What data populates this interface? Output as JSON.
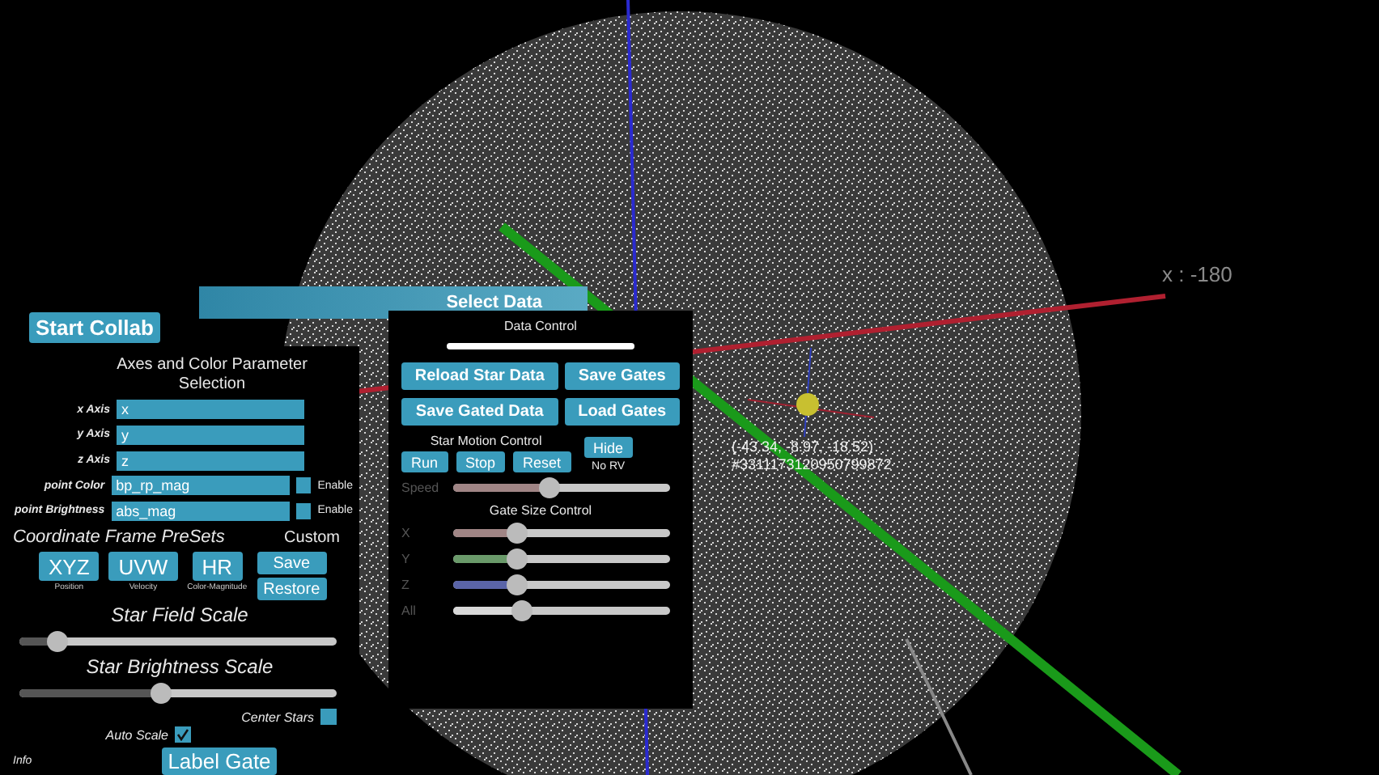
{
  "scene": {
    "axis_label": "x : -180",
    "star_coordinates": "(-43.34, -8.97, -18.52)",
    "star_id": "#3311173120950799872"
  },
  "top_bar": {
    "start_button": "Start Collab",
    "select_data": "Select Data"
  },
  "left_panel": {
    "title": "Axes and Color Parameter Selection",
    "fields": [
      {
        "label": "x Axis",
        "value": "x"
      },
      {
        "label": "y Axis",
        "value": "y"
      },
      {
        "label": "z Axis",
        "value": "z"
      },
      {
        "label": "point Color",
        "value": "bp_rp_mag",
        "enable": {
          "label": "Enable",
          "checked": false
        }
      },
      {
        "label": "point Brightness",
        "value": "abs_mag",
        "enable": {
          "label": "Enable",
          "checked": false
        }
      }
    ],
    "presets": {
      "title": "Coordinate Frame PreSets",
      "custom_label": "Custom",
      "custom_buttons": [
        "Save",
        "Restore"
      ],
      "frames": [
        {
          "label": "XYZ",
          "caption": "Position"
        },
        {
          "label": "UVW",
          "caption": "Velocity"
        },
        {
          "label": "HR",
          "caption": "Color-Magnitude"
        }
      ]
    },
    "sliders": [
      {
        "title": "Star Field Scale",
        "level": 0.12
      },
      {
        "title": "Star Brightness Scale",
        "level": 0.45
      }
    ],
    "checks": [
      {
        "label": "Center Stars",
        "checked": false
      },
      {
        "label": "Auto Scale",
        "checked": true
      }
    ],
    "info_label": "Info",
    "gate_button": "Label Gate"
  },
  "data_panel": {
    "title": "Data Control",
    "progress": {
      "level": 1
    },
    "buttons": [
      "Reload Star Data",
      "Save Gates",
      "Save Gated Data",
      "Load Gates"
    ],
    "motion": {
      "title": "Star Motion Control",
      "buttons": [
        "Run",
        "Stop",
        "Reset"
      ],
      "hide_button": "Hide",
      "hide_caption": "No RV",
      "speed": {
        "label": "Speed",
        "level": 0.45
      }
    },
    "gate": {
      "title": "Gate Size Control",
      "sliders": [
        {
          "label": "X",
          "level": 0.3,
          "color": "#a08585"
        },
        {
          "label": "Y",
          "level": 0.3,
          "color": "#6a9a6a"
        },
        {
          "label": "Z",
          "level": 0.3,
          "color": "#5a64a8"
        },
        {
          "label": "All",
          "level": 0.32,
          "color": "#d8d8d8"
        }
      ]
    }
  }
}
